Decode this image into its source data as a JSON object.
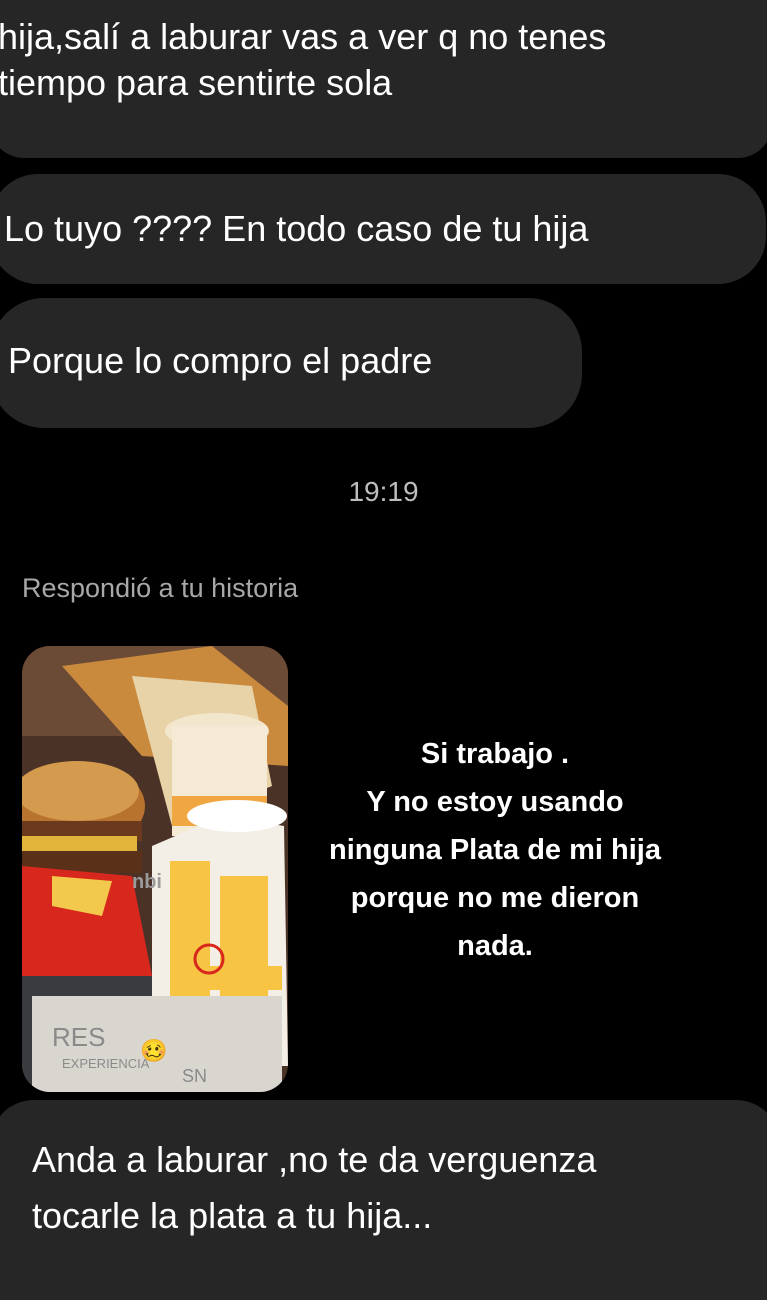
{
  "messages": {
    "top_fragment": {
      "line1": "hija,salí a laburar vas a ver q no tenes",
      "line2": "tiempo para sentirte sola"
    },
    "msg2": "Lo tuyo ???? En todo caso de tu hija",
    "msg3": "Porque lo compro el padre",
    "timestamp": "19:19",
    "reply_label": "Respondió a tu historia",
    "story": {
      "caption_lines": [
        "Si trabajo .",
        "Y no estoy usando",
        "ninguna Plata de mi hija",
        "porque no me dieron",
        "nada."
      ],
      "emoji": "🥴",
      "photo_text_1": "nbi",
      "photo_text_2": "EXPERIENCIA",
      "photo_text_3": "RES",
      "photo_text_4": "SN"
    },
    "last_message": {
      "line1": "Anda a laburar ,no te da verguenza",
      "line2": "tocarle la plata a tu hija..."
    }
  },
  "colors": {
    "background": "#000000",
    "bubble": "#262626",
    "text": "#ffffff",
    "meta_text": "#a8a8a8"
  }
}
